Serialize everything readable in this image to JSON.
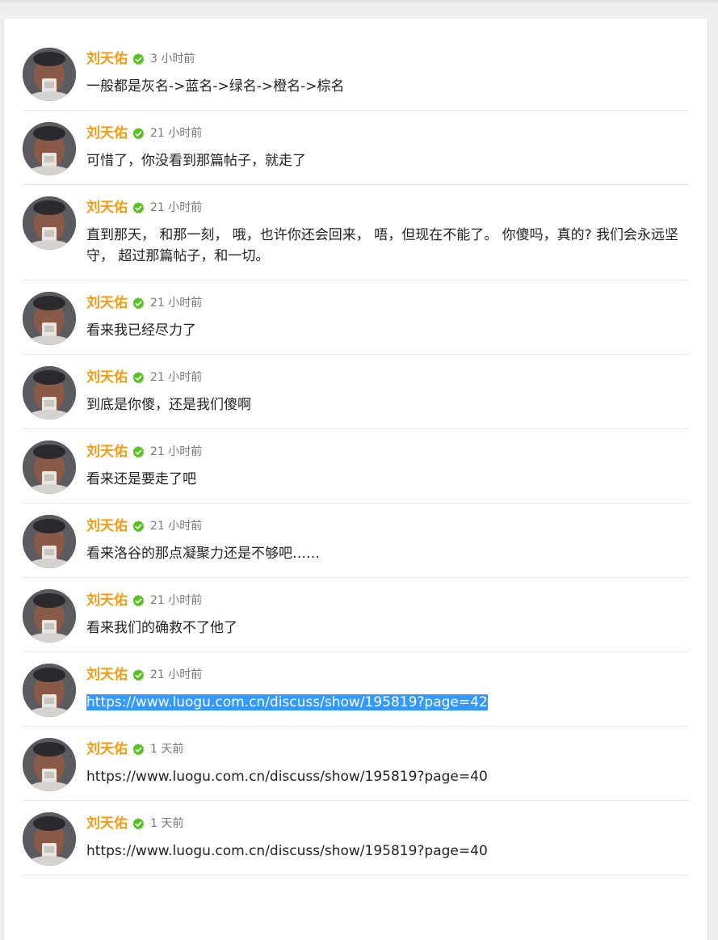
{
  "comments": [
    {
      "author": "刘天佑",
      "time": "3 小时前",
      "content": "一般都是灰名->蓝名->绿名->橙名->棕名"
    },
    {
      "author": "刘天佑",
      "time": "21 小时前",
      "content": "可惜了，你没看到那篇帖子，就走了"
    },
    {
      "author": "刘天佑",
      "time": "21 小时前",
      "content": "直到那天， 和那一刻， 哦，也许你还会回来， 唔，但现在不能了。 你傻吗，真的? 我们会永远坚守， 超过那篇帖子，和一切。"
    },
    {
      "author": "刘天佑",
      "time": "21 小时前",
      "content": "看来我已经尽力了"
    },
    {
      "author": "刘天佑",
      "time": "21 小时前",
      "content": "到底是你傻，还是我们傻啊"
    },
    {
      "author": "刘天佑",
      "time": "21 小时前",
      "content": "看来还是要走了吧"
    },
    {
      "author": "刘天佑",
      "time": "21 小时前",
      "content": "看来洛谷的那点凝聚力还是不够吧……"
    },
    {
      "author": "刘天佑",
      "time": "21 小时前",
      "content": "看来我们的确救不了他了"
    },
    {
      "author": "刘天佑",
      "time": "21 小时前",
      "content": "https://www.luogu.com.cn/discuss/show/195819?page=42"
    },
    {
      "author": "刘天佑",
      "time": "1 天前",
      "content": "https://www.luogu.com.cn/discuss/show/195819?page=40"
    },
    {
      "author": "刘天佑",
      "time": "1 天前",
      "content": "https://www.luogu.com.cn/discuss/show/195819?page=40"
    }
  ],
  "colors": {
    "author": "#f39c11",
    "badge": "#52c41a",
    "selection": "#3399ff"
  }
}
